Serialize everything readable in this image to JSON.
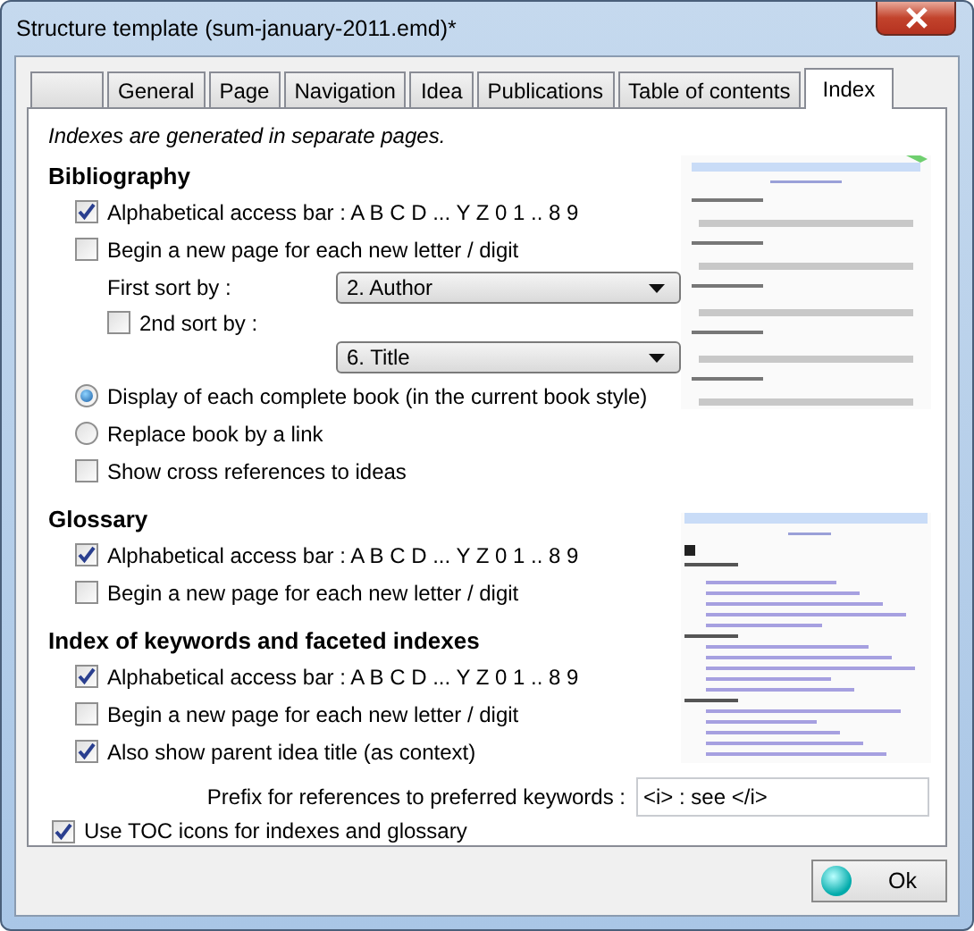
{
  "window": {
    "title": "Structure template (sum-january-2011.emd)*"
  },
  "tabs": [
    {
      "selected": false
    },
    {
      "label": "General",
      "selected": false
    },
    {
      "label": "Page",
      "selected": false
    },
    {
      "label": "Navigation",
      "selected": false
    },
    {
      "label": "Idea",
      "selected": false
    },
    {
      "label": "Publications",
      "selected": false
    },
    {
      "label": "Table of contents",
      "selected": false
    },
    {
      "label": "Index",
      "selected": true
    }
  ],
  "note": "Indexes are generated in separate pages.",
  "sections": [
    {
      "title": "Bibliography",
      "items": [
        {
          "kind": "checkbox",
          "label": "Alphabetical access bar : A B C D ... Y Z 0 1 .. 8 9",
          "checked": true
        },
        {
          "kind": "checkbox",
          "label": "Begin a new page for each new letter / digit",
          "checked": false
        },
        {
          "kind": "select",
          "label": "First sort by :",
          "value": "2. Author"
        },
        {
          "kind": "subcheckbox",
          "label": "2nd sort by :",
          "checked": false
        },
        {
          "kind": "select",
          "value": "6. Title"
        },
        {
          "kind": "radio",
          "label": "Display of each complete book (in the current book style)",
          "selected": true
        },
        {
          "kind": "radio",
          "label": "Replace book by a link",
          "selected": false
        },
        {
          "kind": "checkbox",
          "label": "Show cross references to ideas",
          "checked": false
        }
      ]
    },
    {
      "title": "Glossary",
      "items": [
        {
          "kind": "checkbox",
          "label": "Alphabetical access bar : A B C D ... Y Z 0 1 .. 8 9",
          "checked": true
        },
        {
          "kind": "checkbox",
          "label": "Begin a new page for each new letter / digit",
          "checked": false
        }
      ]
    },
    {
      "title": "Index of keywords and faceted indexes",
      "items": [
        {
          "kind": "checkbox",
          "label": "Alphabetical access bar : A B C D ... Y Z 0 1 .. 8 9",
          "checked": true
        },
        {
          "kind": "checkbox",
          "label": "Begin a new page for each new letter / digit",
          "checked": false
        },
        {
          "kind": "checkbox",
          "label": "Also show parent idea title (as context)",
          "checked": true
        }
      ]
    }
  ],
  "prefix": {
    "label": "Prefix for references to preferred keywords :",
    "value": "<i> : see </i>"
  },
  "toc_icons": {
    "label": "Use TOC icons for indexes and glossary",
    "checked": true
  },
  "ok_button": {
    "label": "Ok"
  }
}
